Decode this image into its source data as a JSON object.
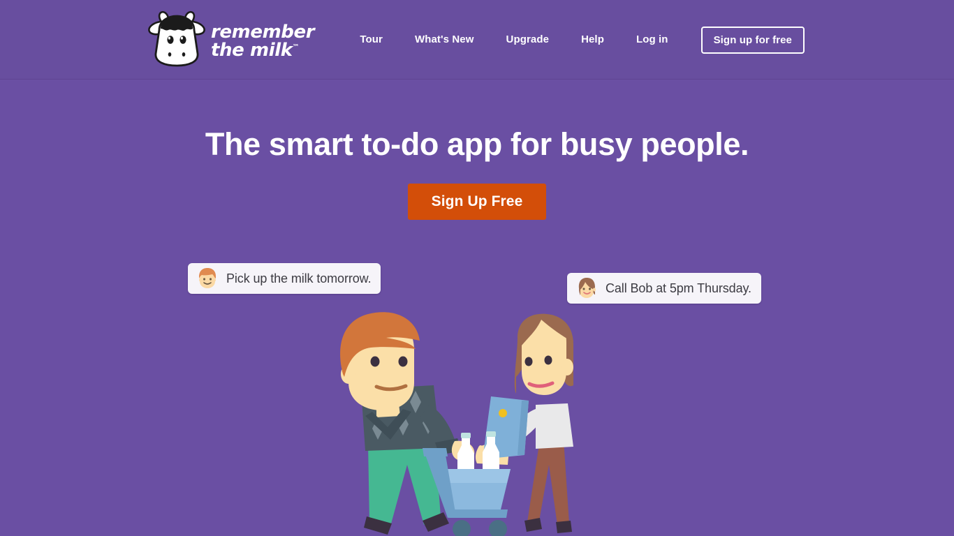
{
  "site": {
    "brand": {
      "logo_icon": "cow-logo-icon",
      "wordmark_line1": "remember",
      "wordmark_line2": "the milk",
      "trademark": "™"
    },
    "background_color": "#6a4fa3",
    "header_color": "#684e9f",
    "accent_color": "#d34e09"
  },
  "nav": {
    "links": [
      {
        "label": "Tour",
        "name": "nav-link-tour"
      },
      {
        "label": "What's New",
        "name": "nav-link-whats-new"
      },
      {
        "label": "Upgrade",
        "name": "nav-link-upgrade"
      },
      {
        "label": "Help",
        "name": "nav-link-help"
      },
      {
        "label": "Log in",
        "name": "nav-link-log-in"
      }
    ],
    "signup_button": "Sign up for free"
  },
  "hero": {
    "headline": "The smart to-do app for busy people.",
    "cta_label": "Sign Up Free"
  },
  "bubbles": [
    {
      "text": "Pick up the milk tomorrow.",
      "avatar": "male-avatar-icon",
      "hair_color": "#e08a50",
      "skin_color": "#fbd9a5"
    },
    {
      "text": "Call Bob at 5pm Thursday.",
      "avatar": "female-avatar-icon",
      "hair_color": "#9b6a4f",
      "skin_color": "#fbd9a5"
    }
  ],
  "illustration": {
    "name": "shopping-couple-illustration",
    "man": {
      "hair_color": "#d2763b",
      "skin_color": "#fbdfa8",
      "sweater_color": "#4a5a63",
      "pants_color": "#45b892",
      "shoe_color": "#3b3040"
    },
    "woman": {
      "hair_color": "#9b6a4f",
      "skin_color": "#fbdfa8",
      "top_color": "#e9e9ea",
      "pants_color": "#9a5c4a",
      "shoe_color": "#3b3040"
    },
    "cart_color": "#7fb0d8",
    "cart_wheel_color": "#4a6f85",
    "tablet_color": "#7fb0d8",
    "tablet_button_color": "#f0c020",
    "bottle_color": "#ffffff",
    "bottle_cap_color": "#bfe3e0"
  }
}
